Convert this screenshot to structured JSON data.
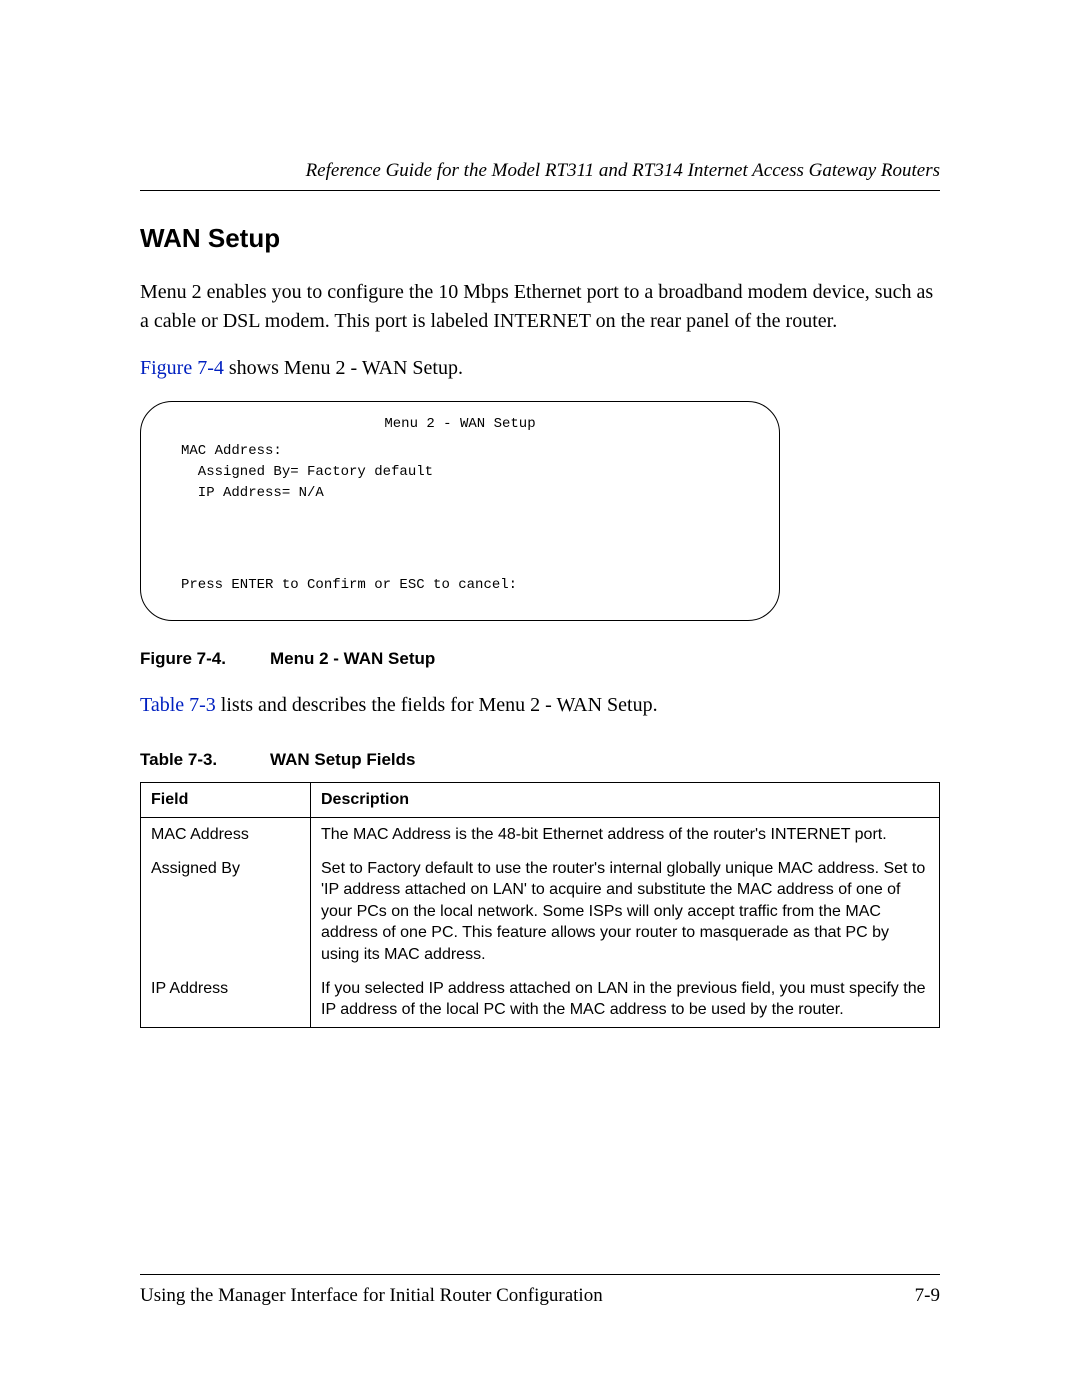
{
  "header": {
    "running_title": "Reference Guide for the Model RT311 and RT314 Internet Access Gateway Routers"
  },
  "section": {
    "title": "WAN Setup",
    "para1": "Menu 2 enables you to configure the 10 Mbps Ethernet port to a broadband modem device, such as a cable or DSL modem. This port is labeled INTERNET on the rear panel of the router.",
    "para2_link": "Figure 7-4",
    "para2_rest": " shows Menu 2 - WAN Setup."
  },
  "terminal": {
    "title": "Menu 2 - WAN Setup",
    "body": "MAC Address:\n  Assigned By= Factory default\n  IP Address= N/A",
    "prompt": "Press ENTER to Confirm or ESC to cancel:"
  },
  "figure": {
    "number": "Figure 7-4.",
    "title": "Menu 2 - WAN Setup"
  },
  "para3": {
    "link": "Table 7-3",
    "rest": " lists and describes the fields for Menu 2 - WAN Setup."
  },
  "table": {
    "number": "Table 7-3.",
    "title": "WAN Setup Fields",
    "headers": {
      "field": "Field",
      "description": "Description"
    },
    "rows": [
      {
        "field": "MAC Address",
        "indent": 0,
        "description": "The MAC Address is the 48-bit Ethernet address of the router's INTERNET port."
      },
      {
        "field": "Assigned By",
        "indent": 1,
        "description": "Set to Factory default to use the router's internal globally unique MAC address. Set to 'IP address attached on LAN' to acquire and substitute the MAC address of one of your PCs on the local network. Some ISPs will only accept traffic from the MAC address of one PC. This feature allows your router to masquerade as that PC by using its MAC address."
      },
      {
        "field": "IP Address",
        "indent": 1,
        "description": "If you selected IP address attached on LAN in the previous field, you must specify the IP address of the local PC with the MAC address to be used by the router."
      }
    ]
  },
  "footer": {
    "left": "Using the Manager Interface for Initial Router Configuration",
    "right": "7-9"
  }
}
